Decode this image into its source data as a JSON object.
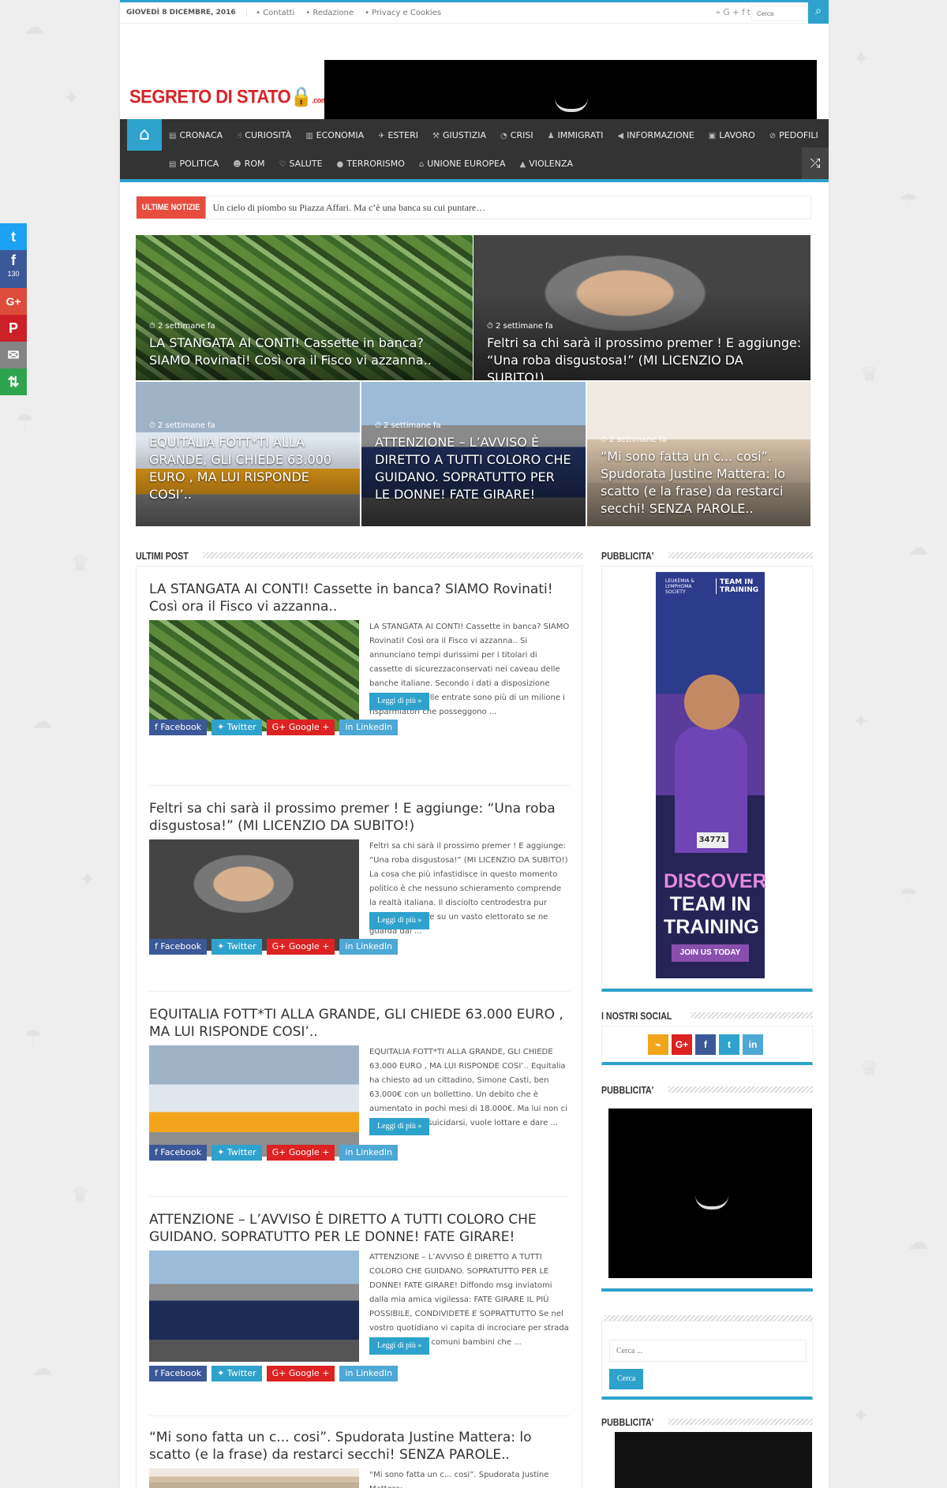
{
  "topbar": {
    "date": "GIOVEDÌ 8 DICEMBRE, 2016",
    "links": [
      "• Contatti",
      "• Redazione",
      "• Privacy e Cookies"
    ],
    "search_placeholder": "Cerca"
  },
  "logo": {
    "text": "SEGRETO DI STATO",
    "suffix": ".com"
  },
  "share_sidebar": {
    "facebook_count": "130"
  },
  "nav": {
    "row1": [
      "CRONACA",
      "CURIOSITÀ",
      "ECONOMIA",
      "ESTERI",
      "GIUSTIZIA",
      "CRISI",
      "IMMIGRATI",
      "INFORMAZIONE",
      "LAVORO",
      "PEDOFILI"
    ],
    "row2": [
      "POLITICA",
      "ROM",
      "SALUTE",
      "TERRORISMO",
      "UNIONE EUROPEA",
      "VIOLENZA"
    ]
  },
  "breaking": {
    "label": "ULTIME NOTIZIE",
    "ticker": "Un cielo di piombo su Piazza Affari. Ma c’è una banca su cui puntare…"
  },
  "slider": [
    {
      "meta": "⏱ 2 settimane fa",
      "title": "LA STANGATA AI CONTI! Cassette in banca? SIAMO Rovinati! Così ora il Fisco vi azzanna.."
    },
    {
      "meta": "⏱ 2 settimane fa",
      "title": "Feltri sa chi sarà il prossimo premer ! E aggiunge: “Una roba disgustosa!” (MI LICENZIO DA SUBITO!)"
    },
    {
      "meta": "⏱ 2 settimane fa",
      "title": "EQUITALIA FOTT*TI ALLA GRANDE, GLI CHIEDE 63.000 EURO , MA LUI RISPONDE COSI’.."
    },
    {
      "meta": "⏱ 2 settimane fa",
      "title": "ATTENZIONE – L’AVVISO È DIRETTO A TUTTI COLORO CHE GUIDANO. SOPRATUTTO PER LE DONNE! FATE GIRARE!"
    },
    {
      "meta": "⏱ 2 settimane fa",
      "title": "“Mi sono fatta un c... cosi”. Spudorata Justine Mattera: lo scatto (e la frase) da restarci secchi! SENZA PAROLE.."
    }
  ],
  "sections": {
    "latest": "ULTIMI POST",
    "ad1": "PUBBLICITA'",
    "social": "I NOSTRI SOCIAL",
    "ad2": "PUBBLICITA'",
    "ad3": "PUBBLICITA'"
  },
  "share_labels": {
    "facebook": "Facebook",
    "twitter": "Twitter",
    "google": "Google +",
    "linkedin": "LinkedIn"
  },
  "read_more": "Leggi di più »",
  "posts": [
    {
      "title": "LA STANGATA AI CONTI! Cassette in banca? SIAMO Rovinati! Così ora il Fisco vi azzanna..",
      "excerpt": "LA STANGATA AI CONTI! Cassette in banca? SIAMO Rovinati! Così ora il Fisco vi azzanna..   Si annunciano tempi durissimi per i titolari di cassette di sicurezzaconservati nei caveau delle banche italiane. Secondo i dati a disposizione dell’Agenzia delle entrate sono più di un milione i risparmiatori che posseggono ..."
    },
    {
      "title": "Feltri sa chi sarà il prossimo premer ! E aggiunge: “Una roba disgustosa!” (MI LICENZIO DA SUBITO!)",
      "excerpt": "Feltri sa chi sarà il prossimo premer ! E aggiunge: “Una roba disgustosa!” (MI LICENZIO DA SUBITO!)     La cosa che più infastidisce in questo momento politico è che nessuno schieramento comprende la realtà italiana. Il disciolto centrodestra pur potendo contare su un vasto elettorato se ne guarda dal ..."
    },
    {
      "title": "EQUITALIA FOTT*TI ALLA GRANDE, GLI CHIEDE 63.000 EURO , MA LUI RISPONDE COSI’..",
      "excerpt": "EQUITALIA FOTT*TI ALLA GRANDE, GLI CHIEDE 63.000 EURO , MA LUI RISPONDE COSI’..    Equitalia ha chiesto ad un cittadino, Simone Casti, ben 63.000€ con un bollettino. Un debito che è aumentato in pochi mesi di 18.000€. Ma lui non ci sta: non vuole suicidarsi, vuole lottare e dare ..."
    },
    {
      "title": "ATTENZIONE – L’AVVISO È DIRETTO A TUTTI COLORO CHE GUIDANO. SOPRATUTTO PER LE DONNE! FATE GIRARE!",
      "excerpt": "ATTENZIONE – L’AVVISO È DIRETTO A TUTTI COLORO CHE GUIDANO. SOPRATUTTO PER LE DONNE! FATE GIRARE!    Diffondo msg inviatomi dalla mia amica vigilessa: FATE GIRARE IL PIÙ POSSIBILE, CONDIVIDETE E SOPRATTUTTO Se nel vostro quotidiano vi capita di incrociare per strada o in altri luoghi comuni bambini che ..."
    },
    {
      "title": "“Mi sono fatta un c... cosi”. Spudorata Justine Mattera: lo scatto (e la frase) da restarci secchi! SENZA PAROLE..",
      "excerpt": "“Mi sono fatta un c... cosi”. Spudorata Justine Mattera:"
    }
  ],
  "sidebar_ad": {
    "org": "LEUKEMIA & LYMPHOMA SOCIETY",
    "program": "TEAM IN TRAINING",
    "headline_1": "DISCOVER",
    "headline_2": "TEAM IN",
    "headline_3": "TRAINING",
    "cta": "JOIN US TODAY",
    "bib": "34771"
  },
  "sidebar_search": {
    "placeholder": "Cerca ...",
    "button": "Cerca"
  },
  "colors": {
    "accent": "#2ea2cc",
    "nav_bg": "#333333",
    "breaking": "#e74c3c"
  }
}
